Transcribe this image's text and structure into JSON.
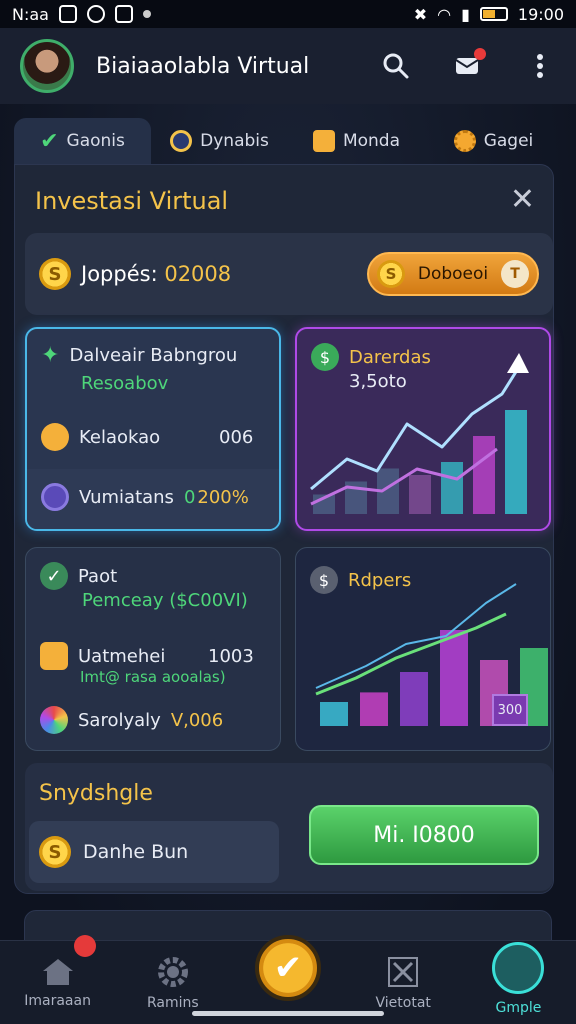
{
  "status_bar": {
    "left_text": "N:aa",
    "time": "19:00"
  },
  "header": {
    "app_title": "Biaiaaolabla Virtual"
  },
  "tabs": [
    {
      "label": "Gaonis",
      "active": true
    },
    {
      "label": "Dynabis"
    },
    {
      "label": "Monda"
    },
    {
      "label": "Gagei"
    }
  ],
  "panel": {
    "title": "Investasi Virtual",
    "close": "✕",
    "balance": {
      "label": "Joppés:",
      "value": "02008",
      "coin": "S"
    },
    "action_button": {
      "label": "Doboeoi",
      "end_icon": "T"
    }
  },
  "cards": {
    "a": {
      "title": "Dalveair Babngrou",
      "subtitle": "Resoabov",
      "row2_label": "Kelaokao",
      "row2_value": "006",
      "row3_label": "Vumiatans",
      "row3_value": "200%",
      "row3_prefix": "0"
    },
    "b": {
      "title": "Darerdas",
      "value": "3,5oto"
    },
    "c": {
      "title": "Paot",
      "subtitle": "Pemceay ($C00VI)",
      "row2_label": "Uatmehei",
      "row2_value": "1003",
      "row2_sub": "Imt@ rasa aooalas)",
      "row3_label": "Sarolyaly",
      "row3_value": "V,006"
    },
    "d": {
      "title": "Rdpers",
      "cube_text": "300"
    }
  },
  "bottom_section": {
    "title": "Snydshgle",
    "sub_label": "Danhe Bun",
    "button_label": "Mi. I0800"
  },
  "bottom_nav": [
    {
      "label": "Imaraaan"
    },
    {
      "label": "Ramins"
    },
    {
      "label": ""
    },
    {
      "label": "Vietotat"
    },
    {
      "label": "Gmple"
    }
  ],
  "colors": {
    "accent_gold": "#f4c34a",
    "accent_green": "#4ed67a",
    "accent_teal": "#3ae0d8",
    "accent_purple": "#b04ae8"
  },
  "chart_b": {
    "bars": [
      {
        "height": 0.15,
        "color": "#4a5a80"
      },
      {
        "height": 0.25,
        "color": "#4a5a80"
      },
      {
        "height": 0.35,
        "color": "#4a5a80"
      },
      {
        "height": 0.3,
        "color": "#7a4a90"
      },
      {
        "height": 0.4,
        "color": "#35a8b8"
      },
      {
        "height": 0.6,
        "color": "#b040c0"
      },
      {
        "height": 0.8,
        "color": "#35b8c8"
      }
    ]
  },
  "chart_d": {
    "bars": [
      {
        "height": 0.2,
        "color": "#3ab8d0"
      },
      {
        "height": 0.28,
        "color": "#c040c0"
      },
      {
        "height": 0.45,
        "color": "#8a40c8"
      },
      {
        "height": 0.8,
        "color": "#b040d0"
      },
      {
        "height": 0.55,
        "color": "#c050b8"
      },
      {
        "height": 0.65,
        "color": "#40c070"
      }
    ]
  }
}
